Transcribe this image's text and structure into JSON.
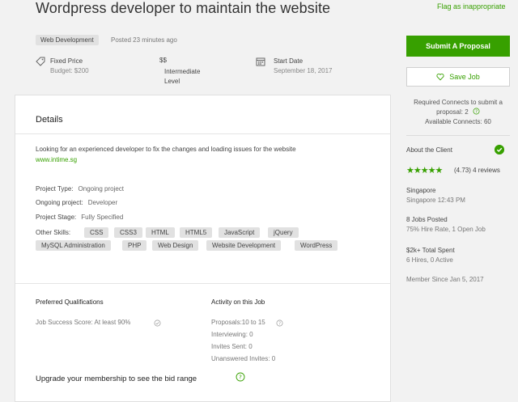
{
  "header": {
    "title": "Wordpress developer to maintain the website",
    "flag_link": "Flag as inappropriate",
    "category": "Web Development",
    "posted": "Posted 23 minutes ago"
  },
  "meta": {
    "price_type": "Fixed Price",
    "budget": "Budget: $200",
    "level_dollars": "$$",
    "level": "Intermediate Level",
    "start_label": "Start Date",
    "start_date": "September 18, 2017"
  },
  "details": {
    "heading": "Details",
    "description": "Looking for an experienced developer to fix the changes and loading issues for the website",
    "link": "www.intime.sg",
    "fields": [
      {
        "label": "Project Type:",
        "value": "Ongoing project"
      },
      {
        "label": "Ongoing project:",
        "value": "Developer"
      },
      {
        "label": "Project Stage:",
        "value": "Fully Specified"
      }
    ],
    "skills_label": "Other Skills:",
    "skills": [
      "CSS",
      "CSS3",
      "HTML",
      "HTML5",
      "JavaScript",
      "jQuery",
      "MySQL Administration",
      "PHP",
      "Web Design",
      "Website Development",
      "WordPress"
    ]
  },
  "qualifications": {
    "heading": "Preferred Qualifications",
    "job_success": "Job Success Score: At least 90%"
  },
  "activity": {
    "heading": "Activity on this Job",
    "proposals": "Proposals:10 to 15",
    "interviewing": "Interviewing: 0",
    "invites": "Invites Sent: 0",
    "unanswered": "Unanswered Invites: 0"
  },
  "upgrade": "Upgrade your membership to see the bid range",
  "sidebar": {
    "submit": "Submit A Proposal",
    "save": "Save Job",
    "connects_required": "Required Connects to submit a proposal: 2",
    "connects_available": "Available Connects: 60",
    "about_heading": "About the Client",
    "rating": "(4.73) 4 reviews",
    "rating_value": 4.73,
    "country": "Singapore",
    "local_time": "Singapore 12:43 PM",
    "jobs_posted": "8 Jobs Posted",
    "hire_rate": "75% Hire Rate, 1 Open Job",
    "total_spent": "$2k+ Total Spent",
    "hires": "6 Hires, 0 Active",
    "member_since": "Member Since Jan 5, 2017"
  },
  "colors": {
    "accent": "#37a000",
    "tag_bg": "#e1e1e1",
    "page_bg": "#f2f2f2"
  },
  "icons": [
    "price-tag-icon",
    "calendar-icon",
    "heart-icon",
    "question-icon",
    "verified-check-icon",
    "star-icon"
  ]
}
